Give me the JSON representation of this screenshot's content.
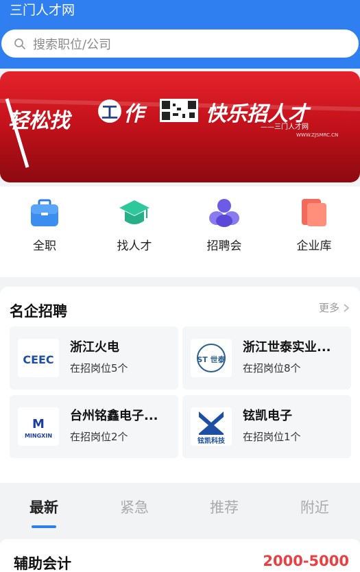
{
  "app": {
    "title": "三门人才网"
  },
  "search": {
    "placeholder": "搜索职位/公司"
  },
  "banner": {
    "left_text_1": "轻松找",
    "left_text_2": "作",
    "left_circle_char": "工",
    "right_text": "快乐招人才",
    "caption": "——三门人才网",
    "url": "WWW.ZJSMRC.CN"
  },
  "quick_nav": [
    {
      "label": "全职",
      "icon": "briefcase-icon"
    },
    {
      "label": "找人才",
      "icon": "graduation-cap-icon"
    },
    {
      "label": "招聘会",
      "icon": "people-group-icon"
    },
    {
      "label": "企业库",
      "icon": "building-cards-icon"
    }
  ],
  "famous_companies": {
    "title": "名企招聘",
    "more_label": "更多",
    "companies": [
      {
        "name": "浙江火电",
        "jobs": "在招岗位5个",
        "logo": "CEEC"
      },
      {
        "name": "浙江世泰实业...",
        "jobs": "在招岗位8个",
        "logo": "ST 世泰"
      },
      {
        "name": "台州铭鑫电子...",
        "jobs": "在招岗位2个",
        "logo": "MINGXIN"
      },
      {
        "name": "铉凯电子",
        "jobs": "在招岗位1个",
        "logo": "铉凯科技"
      }
    ]
  },
  "tabs": [
    {
      "label": "最新",
      "active": true
    },
    {
      "label": "紧急",
      "active": false
    },
    {
      "label": "推荐",
      "active": false
    },
    {
      "label": "附近",
      "active": false
    }
  ],
  "job_preview": {
    "title": "辅助会计",
    "salary": "2000-5000"
  },
  "colors": {
    "primary": "#2f7ff1",
    "salary": "#e94044",
    "banner_red": "#d3141d"
  }
}
